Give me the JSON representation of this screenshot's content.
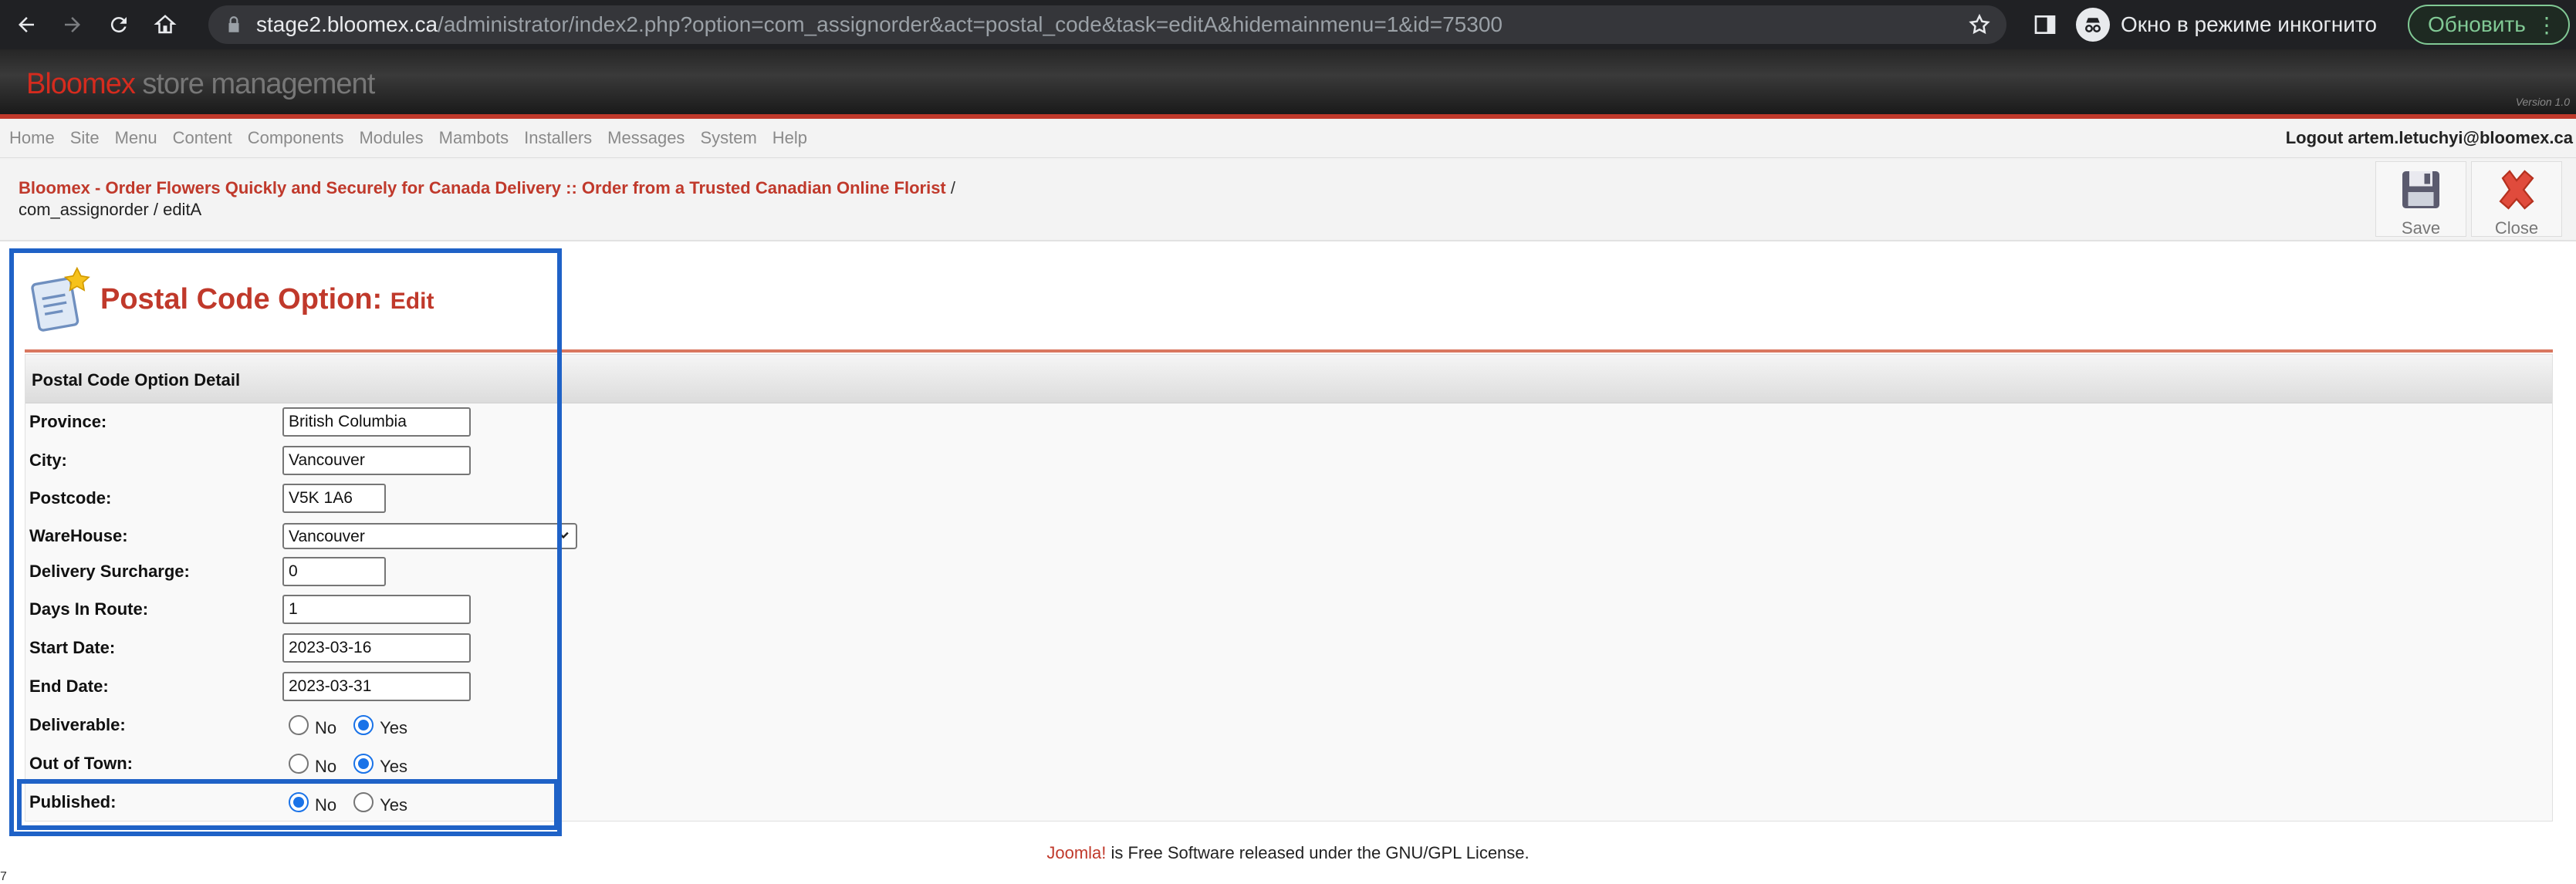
{
  "browser": {
    "url_host": "stage2.bloomex.ca",
    "url_path": "/administrator/index2.php?option=com_assignorder&act=postal_code&task=editA&hidemainmenu=1&id=75300",
    "incognito_label": "Окно в режиме инкогнито",
    "update_label": "Обновить"
  },
  "site": {
    "brand": "Bloomex",
    "brand_sub": "store management",
    "version": "Version 1.0"
  },
  "menu": {
    "items": [
      "Home",
      "Site",
      "Menu",
      "Content",
      "Components",
      "Modules",
      "Mambots",
      "Installers",
      "Messages",
      "System",
      "Help"
    ],
    "logout": "Logout artem.letuchyi@bloomex.ca"
  },
  "breadcrumb": {
    "site_title": "Bloomex - Order Flowers Quickly and Securely for Canada Delivery :: Order from a Trusted Canadian Online Florist",
    "sep": "/",
    "path": "com_assignorder / editA"
  },
  "toolbar": {
    "save_label": "Save",
    "close_label": "Close"
  },
  "page": {
    "title": "Postal Code Option:",
    "title_mode": "Edit",
    "panel_header": "Postal Code Option Detail"
  },
  "form": {
    "province_label": "Province:",
    "province_value": "British Columbia",
    "city_label": "City:",
    "city_value": "Vancouver",
    "postcode_label": "Postcode:",
    "postcode_value": "V5K 1A6",
    "warehouse_label": "WareHouse:",
    "warehouse_value": "Vancouver",
    "surcharge_label": "Delivery Surcharge:",
    "surcharge_value": "0",
    "days_label": "Days In Route:",
    "days_value": "1",
    "start_label": "Start Date:",
    "start_value": "2023-03-16",
    "end_label": "End Date:",
    "end_value": "2023-03-31",
    "deliverable_label": "Deliverable:",
    "out_of_town_label": "Out of Town:",
    "published_label": "Published:",
    "no_label": "No",
    "yes_label": "Yes",
    "deliverable_selected": "Yes",
    "out_of_town_selected": "Yes",
    "published_selected": "No"
  },
  "footer": {
    "joomla": "Joomla!",
    "text": " is Free Software released under the GNU/GPL License."
  },
  "corner_mark": "7",
  "colors": {
    "accent": "#c0392b",
    "highlight": "#1f62c7",
    "radio_checked": "#1a73e8"
  }
}
